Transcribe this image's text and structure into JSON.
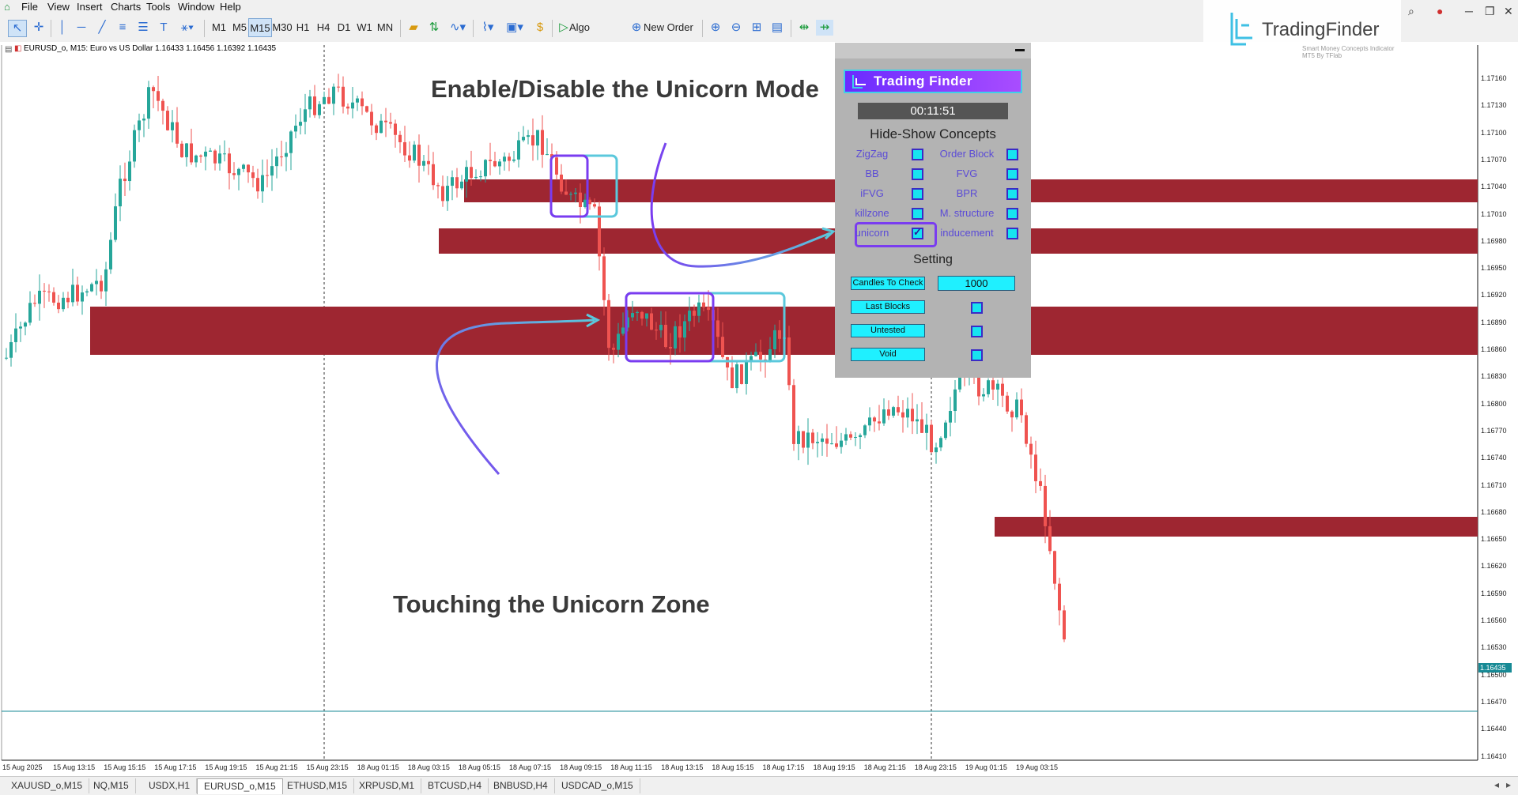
{
  "menu": [
    "File",
    "View",
    "Insert",
    "Charts",
    "Tools",
    "Window",
    "Help"
  ],
  "toolbar": {
    "timeframes": [
      "M1",
      "M5",
      "M15",
      "M30",
      "H1",
      "H4",
      "D1",
      "W1",
      "MN"
    ],
    "active_timeframe": "M15",
    "algo_trading": "Algo Trading",
    "new_order": "New Order"
  },
  "brand_overlay": {
    "name": "TradingFinder",
    "subtitle": "Smart Money Concepts Indicator MT5 By TFlab"
  },
  "chart": {
    "info": "EURUSD_o, M15:  Euro vs US Dollar  1.16433  1.16456  1.16392  1.16435",
    "current_price": "1.16435",
    "price_labels": [
      "1.17160",
      "1.17130",
      "1.17100",
      "1.17070",
      "1.17040",
      "1.17010",
      "1.16980",
      "1.16950",
      "1.16920",
      "1.16890",
      "1.16860",
      "1.16830",
      "1.16800",
      "1.16770",
      "1.16740",
      "1.16710",
      "1.16680",
      "1.16650",
      "1.16620",
      "1.16590",
      "1.16560",
      "1.16530",
      "1.16500",
      "1.16470",
      "1.16440",
      "1.16410"
    ],
    "time_labels": [
      "15 Aug 2025",
      "15 Aug 13:15",
      "15 Aug 15:15",
      "15 Aug 17:15",
      "15 Aug 19:15",
      "15 Aug 21:15",
      "15 Aug 23:15",
      "18 Aug 01:15",
      "18 Aug 03:15",
      "18 Aug 05:15",
      "18 Aug 07:15",
      "18 Aug 09:15",
      "18 Aug 11:15",
      "18 Aug 13:15",
      "18 Aug 15:15",
      "18 Aug 17:15",
      "18 Aug 19:15",
      "18 Aug 21:15",
      "18 Aug 23:15",
      "19 Aug 01:15",
      "19 Aug 03:15"
    ]
  },
  "annotations": {
    "top": "Enable/Disable the Unicorn Mode",
    "bottom": "Touching the Unicorn Zone"
  },
  "panel": {
    "brand": "Trading Finder",
    "timer": "00:11:51",
    "concepts_title": "Hide-Show Concepts",
    "concepts": [
      {
        "label": "ZigZag",
        "checked": false
      },
      {
        "label": "Order Block",
        "checked": false
      },
      {
        "label": "BB",
        "checked": false
      },
      {
        "label": "FVG",
        "checked": false
      },
      {
        "label": "iFVG",
        "checked": false
      },
      {
        "label": "BPR",
        "checked": false
      },
      {
        "label": "killzone",
        "checked": false
      },
      {
        "label": "M. structure",
        "checked": false
      },
      {
        "label": "unicorn",
        "checked": true
      },
      {
        "label": "inducement",
        "checked": false
      }
    ],
    "setting_title": "Setting",
    "candles_label": "Candles To Check",
    "candles_value": "1000",
    "last_blocks": "Last Blocks",
    "untested": "Untested",
    "void": "Void"
  },
  "tabs": [
    "XAUUSD_o,M15",
    "NQ,M15",
    "USDX,H1",
    "EURUSD_o,M15",
    "ETHUSD,M15",
    "XRPUSD,M1",
    "BTCUSD,H4",
    "BNBUSD,H4",
    "USDCAD_o,M15"
  ],
  "active_tab": "EURUSD_o,M15",
  "colors": {
    "zone": "#9e2631",
    "bull": "#26a69a",
    "bear": "#ef5350",
    "box_purple": "#7a3cf0",
    "box_cyan": "#5bc8dc",
    "accent": "#1ff0ff"
  }
}
